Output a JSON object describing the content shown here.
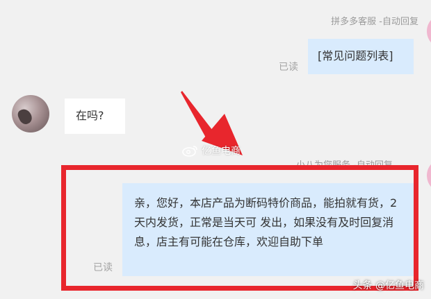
{
  "messages": [
    {
      "sender": "拼多多客服 -自动回复",
      "read_status": "已读",
      "text": "[常见问题列表]"
    },
    {
      "text": "在吗?"
    },
    {
      "sender": "小八为您服务 -自动回复",
      "read_status": "已读",
      "text": "亲，您好，本店产品为断码特价商品，能拍就有货，2天内发货，正常是当天可 发出，如果没有及时回复消息，店主有可能在仓库，欢迎自助下单"
    }
  ],
  "watermark": "亿鱼电商",
  "footer_watermark": "头条 @亿鱼电商",
  "colors": {
    "highlight": "#e8262d",
    "bubble_blue": "#d9ebfd",
    "avatar_pink": "#f0b7cf"
  }
}
